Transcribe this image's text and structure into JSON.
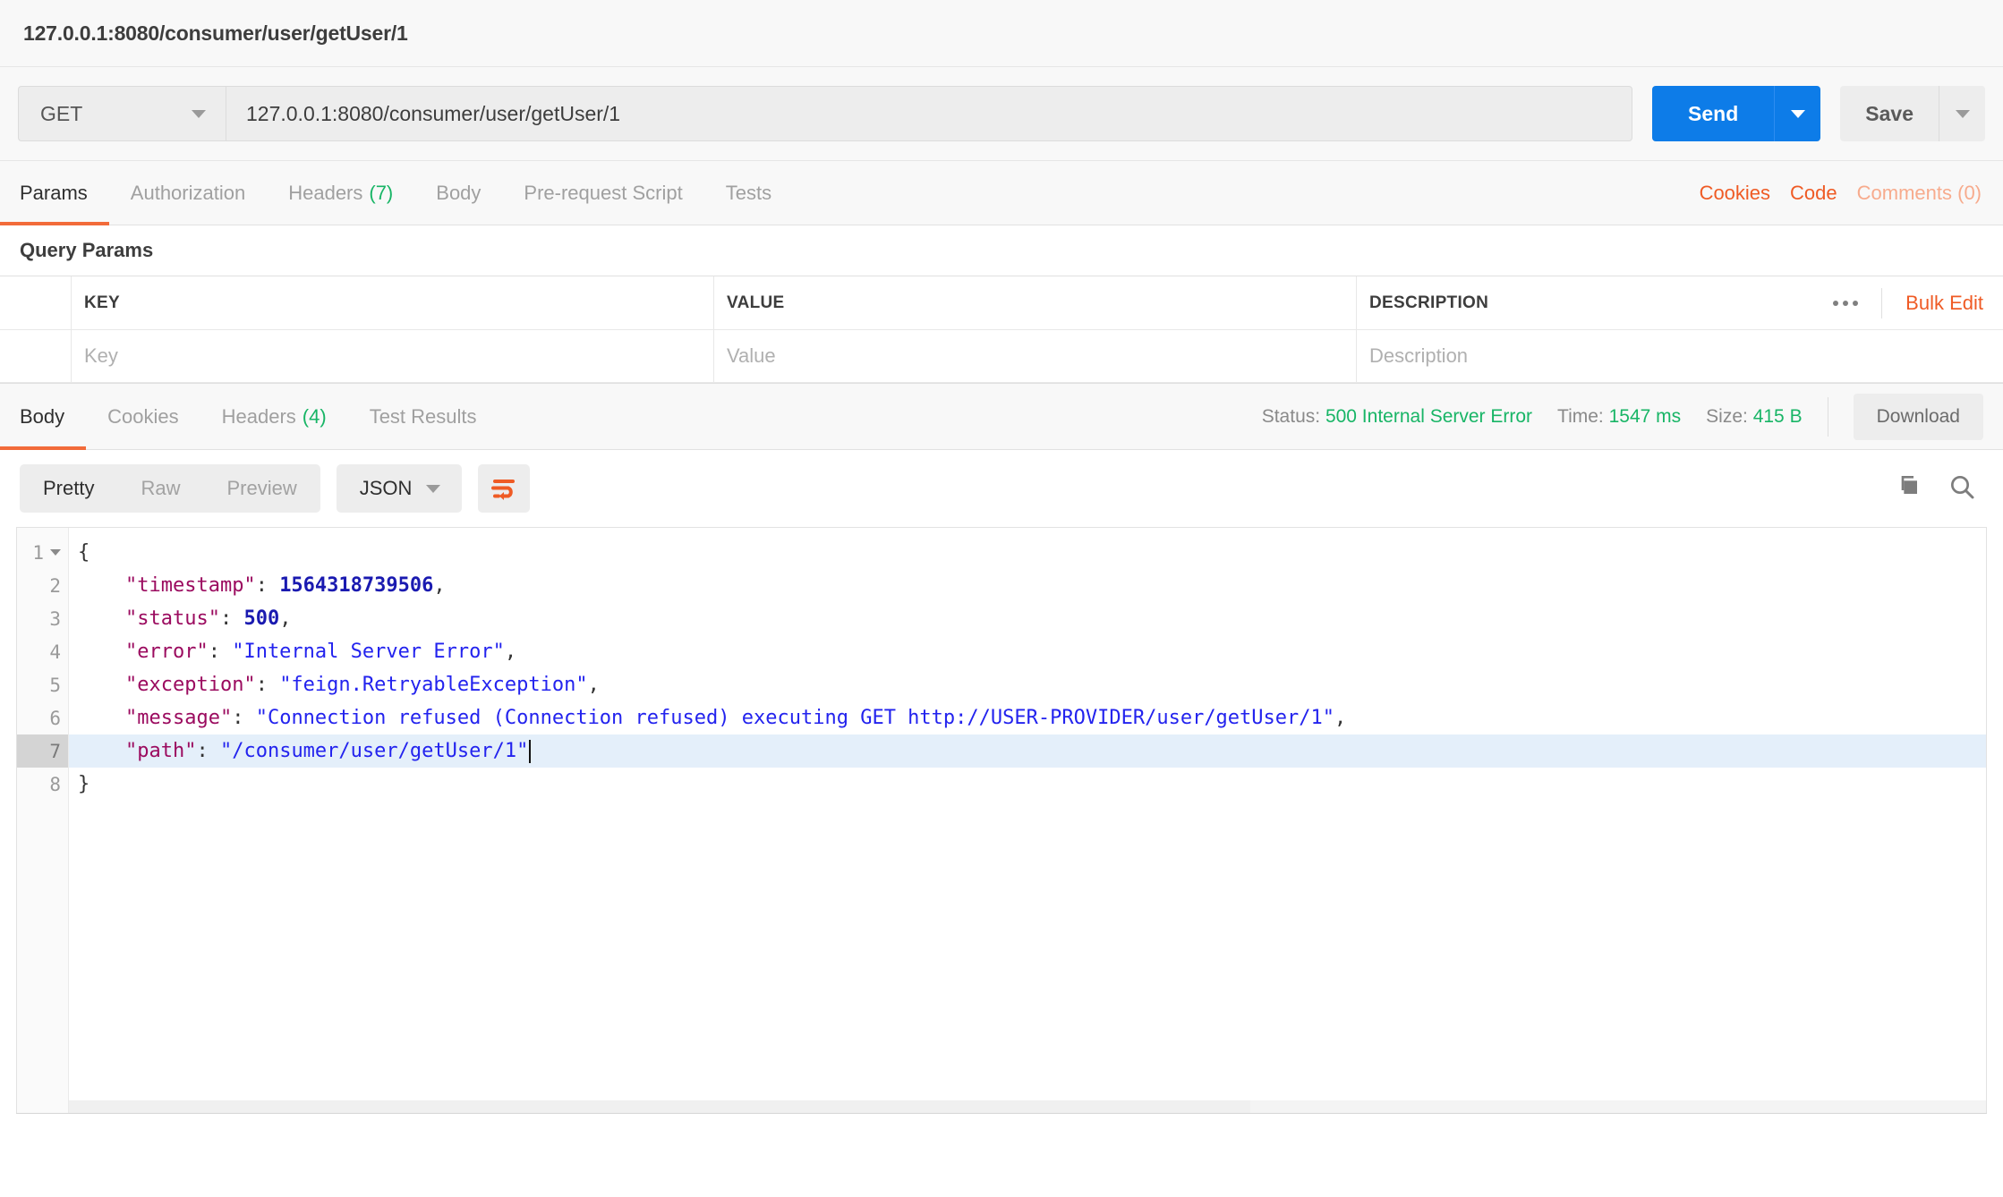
{
  "header": {
    "request_title": "127.0.0.1:8080/consumer/user/getUser/1"
  },
  "url_bar": {
    "method": "GET",
    "url_value": "127.0.0.1:8080/consumer/user/getUser/1",
    "send_label": "Send",
    "save_label": "Save"
  },
  "request_tabs": {
    "items": [
      {
        "label": "Params",
        "count": ""
      },
      {
        "label": "Authorization",
        "count": ""
      },
      {
        "label": "Headers",
        "count": "(7)"
      },
      {
        "label": "Body",
        "count": ""
      },
      {
        "label": "Pre-request Script",
        "count": ""
      },
      {
        "label": "Tests",
        "count": ""
      }
    ],
    "active": "Params",
    "right_links": [
      "Cookies",
      "Code"
    ],
    "comments_label": "Comments (0)"
  },
  "query_params": {
    "section_title": "Query Params",
    "columns": [
      "KEY",
      "VALUE",
      "DESCRIPTION"
    ],
    "row_placeholders": [
      "Key",
      "Value",
      "Description"
    ],
    "bulk_edit_label": "Bulk Edit",
    "more_icon": "ellipsis-icon"
  },
  "response": {
    "tabs": [
      {
        "label": "Body",
        "count": ""
      },
      {
        "label": "Cookies",
        "count": ""
      },
      {
        "label": "Headers",
        "count": "(4)"
      },
      {
        "label": "Test Results",
        "count": ""
      }
    ],
    "active_tab": "Body",
    "status_label": "Status:",
    "status_value": "500 Internal Server Error",
    "time_label": "Time:",
    "time_value": "1547 ms",
    "size_label": "Size:",
    "size_value": "415 B",
    "download_label": "Download"
  },
  "body_toolbar": {
    "view_modes": [
      "Pretty",
      "Raw",
      "Preview"
    ],
    "active_view": "Pretty",
    "format": "JSON",
    "wrap_icon": "word-wrap-icon",
    "copy_icon": "copy-icon",
    "search_icon": "search-icon"
  },
  "code": {
    "active_line": 7,
    "lines": [
      {
        "num": "1",
        "fold": true,
        "tokens": [
          {
            "t": "p",
            "v": "{"
          }
        ]
      },
      {
        "num": "2",
        "fold": false,
        "tokens": [
          {
            "t": "p",
            "v": "    "
          },
          {
            "t": "k",
            "v": "\"timestamp\""
          },
          {
            "t": "p",
            "v": ": "
          },
          {
            "t": "n",
            "v": "1564318739506"
          },
          {
            "t": "p",
            "v": ","
          }
        ]
      },
      {
        "num": "3",
        "fold": false,
        "tokens": [
          {
            "t": "p",
            "v": "    "
          },
          {
            "t": "k",
            "v": "\"status\""
          },
          {
            "t": "p",
            "v": ": "
          },
          {
            "t": "n",
            "v": "500"
          },
          {
            "t": "p",
            "v": ","
          }
        ]
      },
      {
        "num": "4",
        "fold": false,
        "tokens": [
          {
            "t": "p",
            "v": "    "
          },
          {
            "t": "k",
            "v": "\"error\""
          },
          {
            "t": "p",
            "v": ": "
          },
          {
            "t": "s",
            "v": "\"Internal Server Error\""
          },
          {
            "t": "p",
            "v": ","
          }
        ]
      },
      {
        "num": "5",
        "fold": false,
        "tokens": [
          {
            "t": "p",
            "v": "    "
          },
          {
            "t": "k",
            "v": "\"exception\""
          },
          {
            "t": "p",
            "v": ": "
          },
          {
            "t": "s",
            "v": "\"feign.RetryableException\""
          },
          {
            "t": "p",
            "v": ","
          }
        ]
      },
      {
        "num": "6",
        "fold": false,
        "tokens": [
          {
            "t": "p",
            "v": "    "
          },
          {
            "t": "k",
            "v": "\"message\""
          },
          {
            "t": "p",
            "v": ": "
          },
          {
            "t": "s",
            "v": "\"Connection refused (Connection refused) executing GET http://USER-PROVIDER/user/getUser/1\""
          },
          {
            "t": "p",
            "v": ","
          }
        ]
      },
      {
        "num": "7",
        "fold": false,
        "tokens": [
          {
            "t": "p",
            "v": "    "
          },
          {
            "t": "k",
            "v": "\"path\""
          },
          {
            "t": "p",
            "v": ": "
          },
          {
            "t": "s",
            "v": "\"/consumer/user/getUser/1\""
          }
        ]
      },
      {
        "num": "8",
        "fold": false,
        "tokens": [
          {
            "t": "p",
            "v": "}"
          }
        ]
      }
    ]
  },
  "colors": {
    "accent_orange": "#ef5b25",
    "send_blue": "#0d7ce8",
    "status_green": "#18b566",
    "json_key": "#9b0b5f",
    "json_string": "#2323ee",
    "json_number": "#1a1ab0"
  }
}
